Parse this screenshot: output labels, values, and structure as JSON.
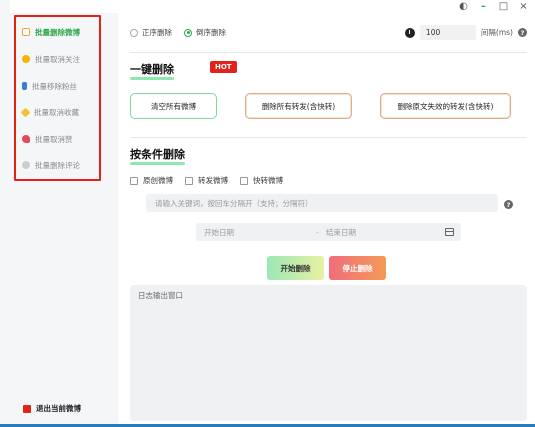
{
  "window": {
    "controls": {
      "theme": "◐",
      "minimize": "–",
      "maximize": "□",
      "close": "×"
    }
  },
  "sidebar": {
    "items": [
      {
        "label": "批量删除微博",
        "icon": "note-edit-icon",
        "color": "#f0a23a",
        "active": true
      },
      {
        "label": "批量取消关注",
        "icon": "person-icon",
        "color": "#f5b400",
        "active": false
      },
      {
        "label": "批量移除粉丝",
        "icon": "user-remove-icon",
        "color": "#3a7bd5",
        "active": false
      },
      {
        "label": "批量取消收藏",
        "icon": "star-icon",
        "color": "#f2c230",
        "active": false
      },
      {
        "label": "批量取消赞",
        "icon": "heart-icon",
        "color": "#e24a5a",
        "active": false
      },
      {
        "label": "批量删除评论",
        "icon": "comment-icon",
        "color": "#9aa3ad",
        "active": false
      }
    ],
    "logout_label": "退出当前微博"
  },
  "main": {
    "order": {
      "option1": "正序删除",
      "option2": "倒序删除",
      "selected": "倒序删除"
    },
    "interval": {
      "value": "100",
      "unit": "间隔(ms)"
    },
    "quick": {
      "title": "一键删除",
      "badge": "HOT",
      "buttons": [
        "清空所有微博",
        "删除所有转发(含快转)",
        "删除原文失效的转发(含快转)"
      ]
    },
    "conditional": {
      "title": "按条件删除",
      "checks": [
        "原创微博",
        "转发微博",
        "快转微博"
      ],
      "keyword_placeholder": "请输入关键词，按回车分隔开（支持；分隔符）",
      "start_date_placeholder": "开始日期",
      "end_date_placeholder": "结束日期",
      "range_sep": "-",
      "start_label": "开始删除",
      "stop_label": "停止删除"
    },
    "log": {
      "title": "日志输出窗口"
    }
  }
}
